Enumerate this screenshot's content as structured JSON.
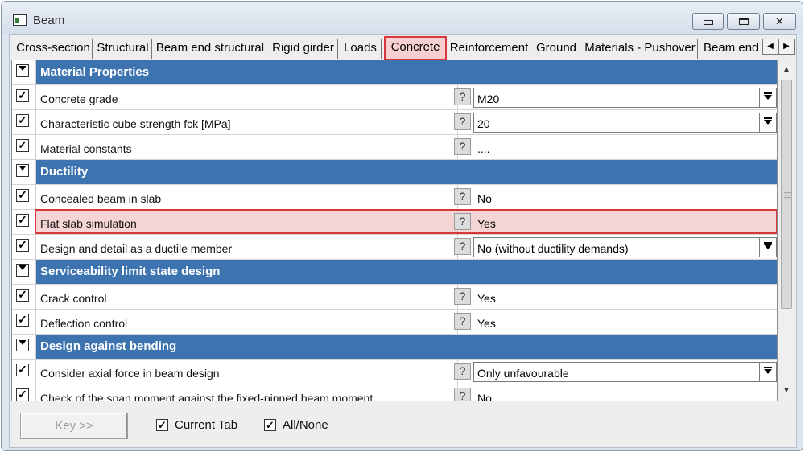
{
  "window": {
    "title": "Beam"
  },
  "tabs": [
    {
      "label": "Cross-section"
    },
    {
      "label": "Structural"
    },
    {
      "label": "Beam end structural"
    },
    {
      "label": "Rigid girder"
    },
    {
      "label": "Loads"
    },
    {
      "label": "Concrete",
      "active": true
    },
    {
      "label": "Reinforcement"
    },
    {
      "label": "Ground"
    },
    {
      "label": "Materials - Pushover"
    },
    {
      "label": "Beam end r"
    }
  ],
  "rows": [
    {
      "type": "section",
      "label": "Material Properties"
    },
    {
      "type": "prop",
      "checked": "✓",
      "label": "Concrete grade",
      "help": "?",
      "value": "M20",
      "dropdown": true
    },
    {
      "type": "prop",
      "checked": "✓",
      "label": "Characteristic cube strength fck [MPa]",
      "help": "?",
      "value": "20",
      "dropdown": true
    },
    {
      "type": "prop",
      "checked": "✓",
      "label": "Material constants",
      "help": "?",
      "value": "....",
      "dropdown": false
    },
    {
      "type": "section",
      "label": "Ductility"
    },
    {
      "type": "prop",
      "checked": "✓",
      "label": "Concealed beam in slab",
      "help": "?",
      "value": "No",
      "dropdown": false
    },
    {
      "type": "prop",
      "checked": "✓",
      "label": "Flat slab simulation",
      "help": "?",
      "value": "Yes",
      "dropdown": false,
      "selected": true
    },
    {
      "type": "prop",
      "checked": "✓",
      "label": "Design and detail as a ductile member",
      "help": "?",
      "value": "No (without ductility demands)",
      "dropdown": true
    },
    {
      "type": "section",
      "label": "Serviceability limit state design"
    },
    {
      "type": "prop",
      "checked": "✓",
      "label": "Crack control",
      "help": "?",
      "value": "Yes",
      "dropdown": false
    },
    {
      "type": "prop",
      "checked": "✓",
      "label": "Deflection control",
      "help": "?",
      "value": "Yes",
      "dropdown": false
    },
    {
      "type": "section",
      "label": "Design against bending"
    },
    {
      "type": "prop",
      "checked": "✓",
      "label": "Consider axial force in beam design",
      "help": "?",
      "value": "Only unfavourable",
      "dropdown": true
    },
    {
      "type": "prop",
      "checked": "✓",
      "label": "Check of the span moment against the fixed-pinned beam moment",
      "help": "?",
      "value": "No",
      "dropdown": false
    }
  ],
  "footer": {
    "key_label": "Key >>",
    "current_tab_label": "Current Tab",
    "current_tab_checked": "✓",
    "all_none_label": "All/None",
    "all_none_checked": "✓"
  },
  "colors": {
    "section_header": "#3d74b0",
    "selection_fill": "#f5d4d6",
    "selection_border": "#d7373b"
  },
  "icons": {
    "app": "beam-window-icon",
    "help": "question-mark-icon",
    "dropdown": "chevron-down-icon"
  }
}
